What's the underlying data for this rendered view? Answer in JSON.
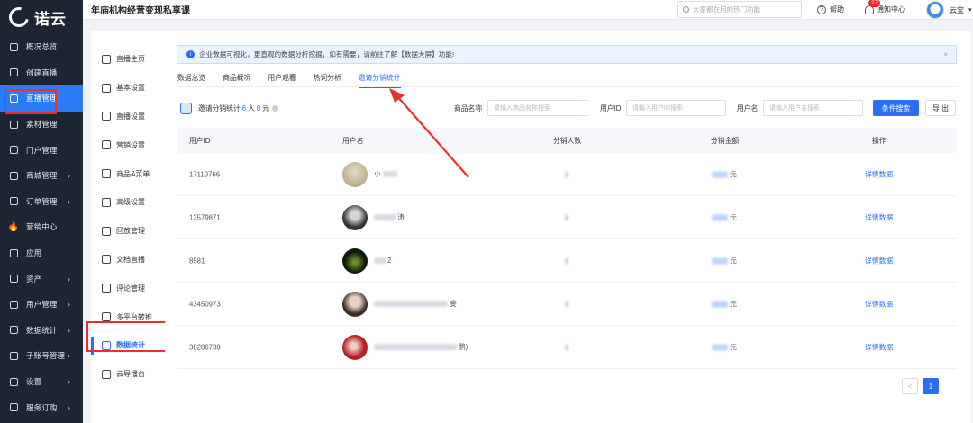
{
  "app": {
    "logo_text": "诺云",
    "page_title": "年庙机构经营变现私享课"
  },
  "header": {
    "search_placeholder": "大家都在用的热门功能",
    "help_label": "帮助",
    "notice_label": "通知中心",
    "notice_badge": "27",
    "user_name": "云宝"
  },
  "sidebar": {
    "items": [
      {
        "label": "概况总览",
        "icon": "overview-icon"
      },
      {
        "label": "创建直播",
        "icon": "create-live-icon"
      },
      {
        "label": "直播管理",
        "icon": "live-manage-icon",
        "active": true
      },
      {
        "label": "素材管理",
        "icon": "folder-icon"
      },
      {
        "label": "门户管理",
        "icon": "portal-icon"
      },
      {
        "label": "商城管理",
        "icon": "shop-icon",
        "arrow": true
      },
      {
        "label": "订单管理",
        "icon": "order-icon",
        "arrow": true
      },
      {
        "label": "营销中心",
        "icon": "fire-icon"
      },
      {
        "label": "应用",
        "icon": "apps-icon"
      },
      {
        "label": "资产",
        "icon": "asset-icon",
        "arrow": true
      },
      {
        "label": "用户管理",
        "icon": "user-icon",
        "arrow": true
      },
      {
        "label": "数据统计",
        "icon": "stats-icon",
        "arrow": true
      },
      {
        "label": "子账号管理",
        "icon": "subaccount-icon",
        "arrow": true
      },
      {
        "label": "设置",
        "icon": "settings-icon",
        "arrow": true
      },
      {
        "label": "服务订购",
        "icon": "service-icon",
        "arrow": true
      }
    ]
  },
  "subnav": {
    "items": [
      {
        "label": "直播主页"
      },
      {
        "label": "基本设置"
      },
      {
        "label": "直播设置"
      },
      {
        "label": "营销设置"
      },
      {
        "label": "商品&菜单"
      },
      {
        "label": "高级设置"
      },
      {
        "label": "回放管理"
      },
      {
        "label": "文档直播"
      },
      {
        "label": "评论管理"
      },
      {
        "label": "多平台转推"
      },
      {
        "label": "数据统计",
        "active": true
      },
      {
        "label": "云导播台"
      }
    ]
  },
  "alert": {
    "text": "企业数据可视化，更直观的数据分析挖掘，如有需要，请前往了解【数据大屏】功能!"
  },
  "tabs": [
    "数据总览",
    "商品概况",
    "用户观看",
    "热词分析",
    "邀请分销统计"
  ],
  "active_tab": "邀请分销统计",
  "stats": {
    "prefix": "邀请分销统计",
    "people": "6",
    "people_unit": "人",
    "amount": "0",
    "amount_unit": "元"
  },
  "filters": {
    "product_label": "商品名称",
    "product_placeholder": "请输入商品名称搜索",
    "uid_label": "用户ID",
    "uid_placeholder": "请输入用户ID搜索",
    "uname_label": "用户名",
    "uname_placeholder": "请输入用户名搜索",
    "search_button": "条件搜索",
    "export_button": "导 出"
  },
  "table": {
    "columns": [
      "用户ID",
      "用户名",
      "分销人数",
      "分销金额",
      "操作"
    ],
    "rows": [
      {
        "uid": "17119766",
        "name_visible": "小",
        "unit": "元",
        "action": "详情数据"
      },
      {
        "uid": "13579871",
        "name_visible": "涛",
        "unit": "元",
        "action": "详情数据"
      },
      {
        "uid": "8581",
        "name_visible": "2",
        "unit": "元",
        "action": "详情数据"
      },
      {
        "uid": "43450973",
        "name_visible": "斐",
        "unit": "元",
        "action": "详情数据"
      },
      {
        "uid": "38286738",
        "name_visible": "鹏)",
        "unit": "元",
        "action": "详情数据"
      }
    ]
  },
  "pager": {
    "prev": "<",
    "current": "1"
  },
  "colors": {
    "accent": "#2b6ef6",
    "sidebar_bg": "#1e2532",
    "annotation": "#e8312e"
  }
}
